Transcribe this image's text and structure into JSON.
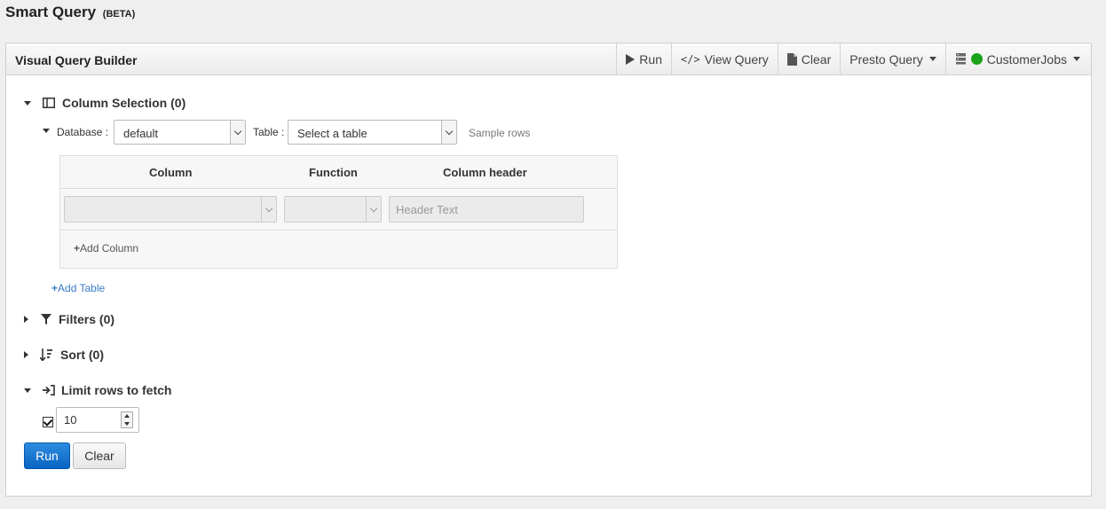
{
  "page": {
    "title": "Smart Query",
    "badge": "(BETA)"
  },
  "panel": {
    "title": "Visual Query Builder",
    "toolbar": {
      "run": "Run",
      "view_query": "View Query",
      "clear": "Clear",
      "engine": "Presto Query",
      "datasource": "CustomerJobs",
      "datasource_status_color": "#1aa31a"
    }
  },
  "column_selection": {
    "title": "Column Selection (0)",
    "database_label": "Database :",
    "database_value": "default",
    "table_label": "Table :",
    "table_value": "Select a table",
    "sample_rows": "Sample rows",
    "headers": {
      "column": "Column",
      "function": "Function",
      "column_header": "Column header"
    },
    "header_placeholder": "Header Text",
    "add_column": "Add Column",
    "add_table": "Add Table"
  },
  "filters": {
    "title": "Filters (0)"
  },
  "sort": {
    "title": "Sort (0)"
  },
  "limit": {
    "title": "Limit rows to fetch",
    "checked": true,
    "value": "10"
  },
  "actions": {
    "run": "Run",
    "clear": "Clear"
  },
  "colors": {
    "primary": "#0a64c2",
    "link": "#3a7bc8"
  }
}
